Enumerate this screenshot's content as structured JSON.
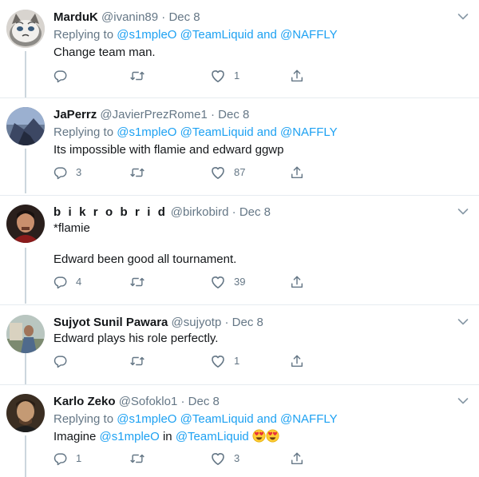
{
  "replying_label": "Replying to",
  "and_label": "and",
  "tweets": [
    {
      "name": "MarduK",
      "handle": "@ivanin89",
      "dot": "·",
      "time": "Dec 8",
      "replying_to": [
        "@s1mpleO",
        "@TeamLiquid",
        "@NAFFLY"
      ],
      "lines": [
        "Change team man."
      ],
      "replies": "",
      "retweets": "",
      "likes": "1"
    },
    {
      "name": "JaPerrz",
      "handle": "@JavierPrezRome1",
      "dot": "·",
      "time": "Dec 8",
      "replying_to": [
        "@s1mpleO",
        "@TeamLiquid",
        "@NAFFLY"
      ],
      "lines": [
        "Its impossible with flamie and edward ggwp"
      ],
      "replies": "3",
      "retweets": "",
      "likes": "87"
    },
    {
      "name": "b i k r o b r i d",
      "handle": "@birkobird",
      "dot": "·",
      "time": "Dec 8",
      "lines": [
        "*flamie",
        "Edward been good all tournament."
      ],
      "replies": "4",
      "retweets": "",
      "likes": "39"
    },
    {
      "name": "Sujyot Sunil Pawara",
      "handle": "@sujyotp",
      "dot": "·",
      "time": "Dec 8",
      "lines": [
        "Edward plays his role perfectly."
      ],
      "replies": "",
      "retweets": "",
      "likes": "1"
    },
    {
      "name": "Karlo Zeko",
      "handle": "@Sofoklo1",
      "dot": "·",
      "time": "Dec 8",
      "replying_to": [
        "@s1mpleO",
        "@TeamLiquid",
        "@NAFFLY"
      ],
      "body_text": {
        "imagine": "Imagine",
        "m1": "@s1mpleO",
        "in": "in",
        "m2": "@TeamLiquid"
      },
      "emoji": [
        "heart-eyes-emoji",
        "heart-eyes-emoji"
      ],
      "replies": "1",
      "retweets": "",
      "likes": "3"
    }
  ],
  "colors": {
    "text": "#14171a",
    "secondary": "#657786",
    "link": "#1da1f2",
    "divider": "#e6ecf0",
    "thread_line": "#ccd6dd"
  },
  "icons": [
    "reply-icon",
    "retweet-icon",
    "like-icon",
    "share-icon",
    "caret-down-icon"
  ]
}
